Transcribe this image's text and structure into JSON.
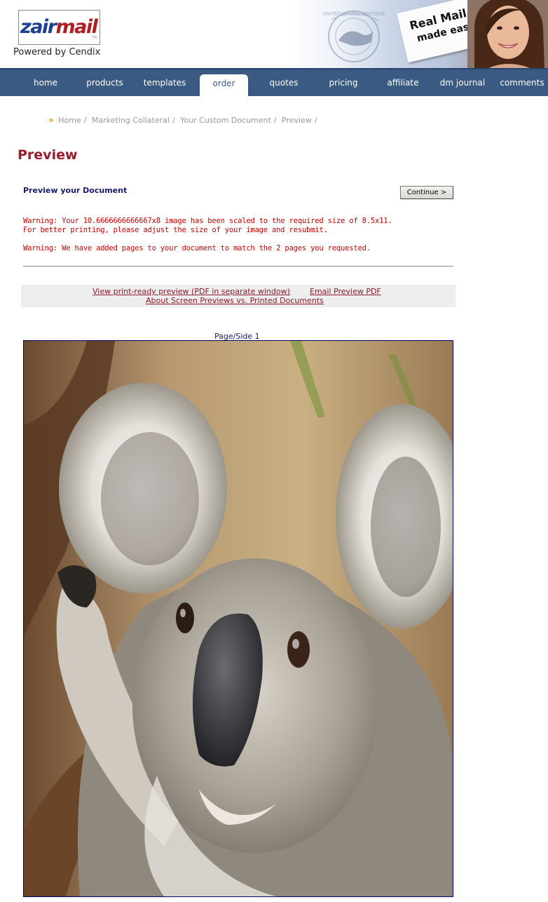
{
  "brand": {
    "logo_part1": "zair",
    "logo_part2": "mail",
    "trademark": "TM",
    "tagline": "Powered by Cendix"
  },
  "banner": {
    "card_line1": "Real Mail",
    "card_line2": "made easy",
    "stamp_text": "UNITED STATES POSTAGE"
  },
  "nav": {
    "items": [
      {
        "label": "home"
      },
      {
        "label": "products"
      },
      {
        "label": "templates"
      },
      {
        "label": "order"
      },
      {
        "label": "quotes"
      },
      {
        "label": "pricing"
      },
      {
        "label": "affiliate"
      },
      {
        "label": "dm journal"
      },
      {
        "label": "comments"
      }
    ],
    "active": "order"
  },
  "breadcrumb": {
    "arrow": "»",
    "items": [
      "Home",
      "Marketing Collateral",
      "Your Custom Document",
      "Preview"
    ],
    "separator": "/"
  },
  "page": {
    "title": "Preview",
    "subheading": "Preview your Document",
    "continue_label": "Continue >",
    "warning1_line1": "Warning: Your 10.6666666666667x8 image has been scaled to the required size of 8.5x11.",
    "warning1_line2": "For better printing, please adjust the size of your image and resubmit.",
    "warning2": "Warning: We have added pages to your document to match the 2 pages you requested."
  },
  "links": {
    "print_preview": "View print-ready preview (PDF in separate window)",
    "email_preview": "Email Preview PDF",
    "about_previews": "About Screen Previews vs. Printed Documents"
  },
  "preview": {
    "page_label": "Page/Side 1",
    "image_subject": "koala"
  },
  "colors": {
    "nav_bg": "#3b5a83",
    "title": "#9b1a2a",
    "warning": "#cc0000",
    "link": "#8b1a2a",
    "heading": "#1a1a6e"
  }
}
